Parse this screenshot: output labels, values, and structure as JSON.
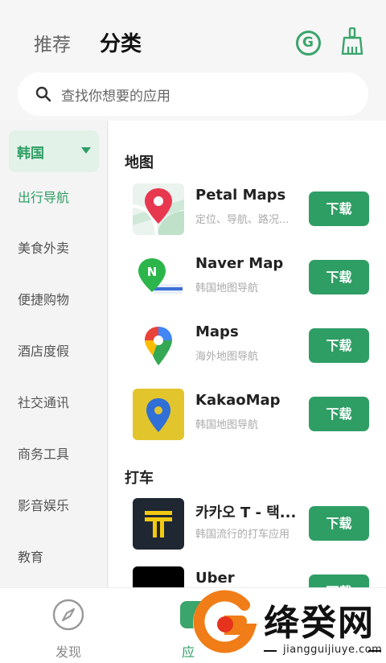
{
  "header": {
    "tabs": [
      "推荐",
      "分类"
    ],
    "active_tab": "分类",
    "icons": [
      "g-icon",
      "broom-clean-icon"
    ],
    "accent_color": "#3aa56c"
  },
  "search": {
    "placeholder": "查找你想要的应用"
  },
  "sidebar": {
    "region": "韩国",
    "items": [
      "出行导航",
      "美食外卖",
      "便捷购物",
      "酒店度假",
      "社交通讯",
      "商务工具",
      "影音娱乐",
      "教育"
    ],
    "active_item": "出行导航"
  },
  "sections": [
    {
      "title": "地图",
      "apps": [
        {
          "name": "Petal Maps",
          "desc": "定位、导航、路况...",
          "button": "下载"
        },
        {
          "name": "Naver Map",
          "desc": "韩国地图导航",
          "button": "下载"
        },
        {
          "name": "Maps",
          "desc": "海外地图导航",
          "button": "下载"
        },
        {
          "name": "KakaoMap",
          "desc": "韩国地图导航",
          "button": "下载"
        }
      ]
    },
    {
      "title": "打车",
      "apps": [
        {
          "name": "카카오 T - 택...",
          "desc": "韩国流行的打车应用",
          "button": "下载"
        },
        {
          "name": "Uber",
          "desc": "",
          "button": "下载"
        }
      ]
    }
  ],
  "bottom_nav": [
    {
      "label": "发现",
      "icon": "compass-icon"
    },
    {
      "label": "应",
      "icon": "apps-icon"
    }
  ],
  "watermark": {
    "text": "绛癸网",
    "url": "jiangguijiuye.com"
  }
}
